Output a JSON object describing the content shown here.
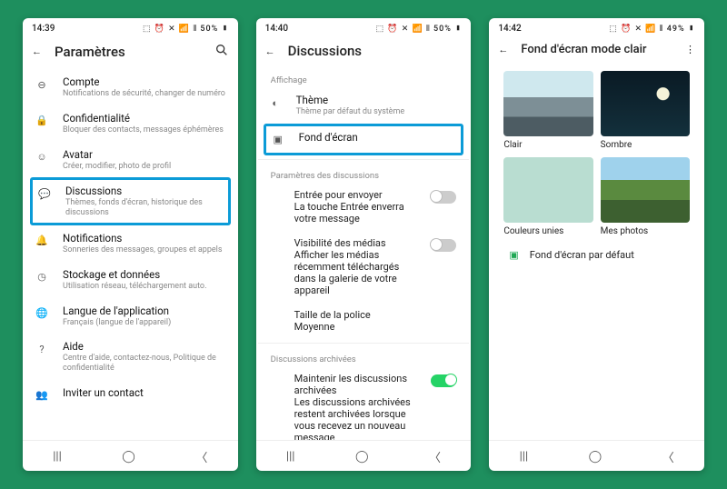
{
  "screen1": {
    "time": "14:39",
    "status": "⬚ ⏰ ✕ 📶 ⫴ 50% ▮",
    "title": "Paramètres",
    "items": [
      {
        "label": "Compte",
        "sub": "Notifications de sécurité, changer de numéro",
        "icon": "key-icon"
      },
      {
        "label": "Confidentialité",
        "sub": "Bloquer des contacts, messages éphémères",
        "icon": "lock-icon"
      },
      {
        "label": "Avatar",
        "sub": "Créer, modifier, photo de profil",
        "icon": "avatar-icon"
      },
      {
        "label": "Discussions",
        "sub": "Thèmes, fonds d'écran, historique des discussions",
        "icon": "chat-icon",
        "highlight": true
      },
      {
        "label": "Notifications",
        "sub": "Sonneries des messages, groupes et appels",
        "icon": "bell-icon"
      },
      {
        "label": "Stockage et données",
        "sub": "Utilisation réseau, téléchargement auto.",
        "icon": "storage-icon"
      },
      {
        "label": "Langue de l'application",
        "sub": "Français (langue de l'appareil)",
        "icon": "globe-icon"
      },
      {
        "label": "Aide",
        "sub": "Centre d'aide, contactez-nous, Politique de confidentialité",
        "icon": "help-icon"
      },
      {
        "label": "Inviter un contact",
        "sub": "",
        "icon": "invite-icon"
      }
    ]
  },
  "screen2": {
    "time": "14:40",
    "status": "⬚ ⏰ ✕ 📶 ⫴ 50% ▮",
    "title": "Discussions",
    "section_affichage": "Affichage",
    "theme": {
      "label": "Thème",
      "sub": "Thème par défaut du système"
    },
    "wallpaper": {
      "label": "Fond d'écran"
    },
    "section_params": "Paramètres des discussions",
    "entree": {
      "label": "Entrée pour envoyer",
      "sub": "La touche Entrée enverra votre message"
    },
    "visibilite": {
      "label": "Visibilité des médias",
      "sub": "Afficher les médias récemment téléchargés dans la galerie de votre appareil"
    },
    "taille": {
      "label": "Taille de la police",
      "sub": "Moyenne"
    },
    "section_archived": "Discussions archivées",
    "archived": {
      "label": "Maintenir les discussions archivées",
      "sub": "Les discussions archivées restent archivées lorsque vous recevez un nouveau message"
    }
  },
  "screen3": {
    "time": "14:42",
    "status": "⬚ ⏰ ✕ 📶 ⫴ 49% ▮",
    "title": "Fond d'écran mode clair",
    "clair": "Clair",
    "sombre": "Sombre",
    "unies": "Couleurs unies",
    "photos": "Mes photos",
    "default": "Fond d'écran par défaut"
  }
}
